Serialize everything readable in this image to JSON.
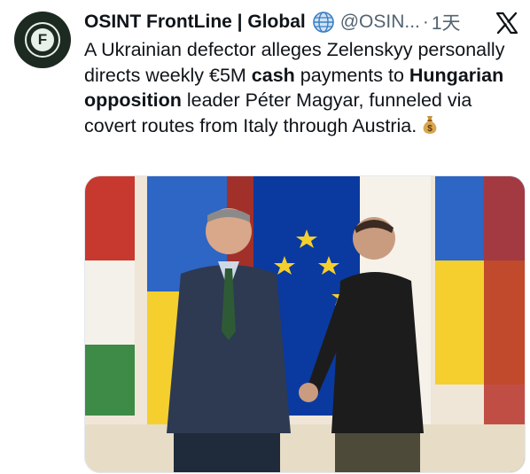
{
  "tweet": {
    "author_name": "OSINT FrontLine | Global",
    "handle": "@OSIN...",
    "separator": "·",
    "timestamp": "1天",
    "avatar_letter": "F",
    "text_parts": {
      "p1": "A Ukrainian defector alleges Zelenskyy personally directs weekly €5M ",
      "b1": "cash",
      "p2": " payments to ",
      "b2": "Hungarian opposition",
      "p3": " leader Péter Magyar, funneled via covert routes from Italy through Austria."
    }
  },
  "icons": {
    "verified": "globe-badge-icon",
    "platform": "x-logo-icon",
    "emoji": "money-bag-icon"
  },
  "colors": {
    "text": "#0f1419",
    "secondary": "#536471",
    "avatar_bg": "#1c2a22",
    "flag_blue": "#1f5fbf",
    "flag_yellow": "#f5cf2e",
    "eu_blue": "#003399"
  }
}
